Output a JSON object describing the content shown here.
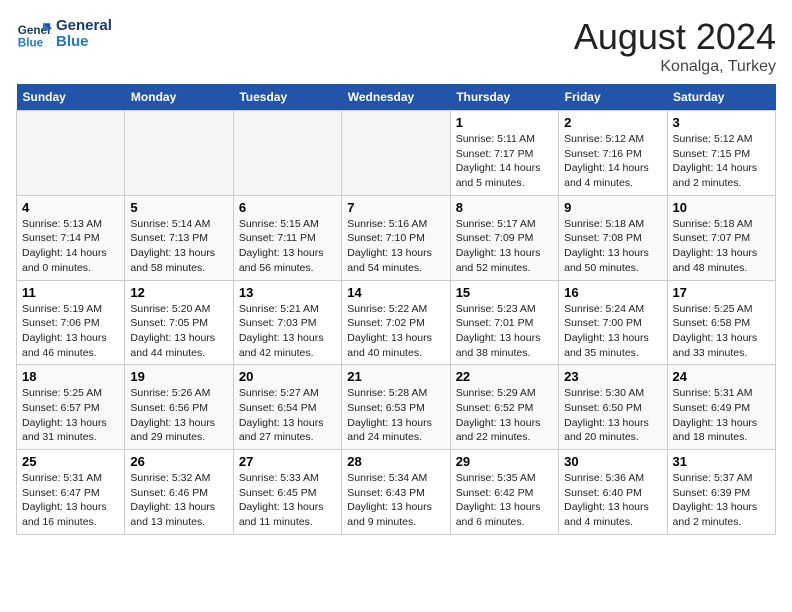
{
  "header": {
    "logo_text_general": "General",
    "logo_text_blue": "Blue",
    "month": "August 2024",
    "location": "Konalga, Turkey"
  },
  "days_of_week": [
    "Sunday",
    "Monday",
    "Tuesday",
    "Wednesday",
    "Thursday",
    "Friday",
    "Saturday"
  ],
  "weeks": [
    [
      {
        "day": null
      },
      {
        "day": null
      },
      {
        "day": null
      },
      {
        "day": null
      },
      {
        "day": "1",
        "sunrise": "5:11 AM",
        "sunset": "7:17 PM",
        "daylight": "14 hours and 5 minutes."
      },
      {
        "day": "2",
        "sunrise": "5:12 AM",
        "sunset": "7:16 PM",
        "daylight": "14 hours and 4 minutes."
      },
      {
        "day": "3",
        "sunrise": "5:12 AM",
        "sunset": "7:15 PM",
        "daylight": "14 hours and 2 minutes."
      }
    ],
    [
      {
        "day": "4",
        "sunrise": "5:13 AM",
        "sunset": "7:14 PM",
        "daylight": "14 hours and 0 minutes."
      },
      {
        "day": "5",
        "sunrise": "5:14 AM",
        "sunset": "7:13 PM",
        "daylight": "13 hours and 58 minutes."
      },
      {
        "day": "6",
        "sunrise": "5:15 AM",
        "sunset": "7:11 PM",
        "daylight": "13 hours and 56 minutes."
      },
      {
        "day": "7",
        "sunrise": "5:16 AM",
        "sunset": "7:10 PM",
        "daylight": "13 hours and 54 minutes."
      },
      {
        "day": "8",
        "sunrise": "5:17 AM",
        "sunset": "7:09 PM",
        "daylight": "13 hours and 52 minutes."
      },
      {
        "day": "9",
        "sunrise": "5:18 AM",
        "sunset": "7:08 PM",
        "daylight": "13 hours and 50 minutes."
      },
      {
        "day": "10",
        "sunrise": "5:18 AM",
        "sunset": "7:07 PM",
        "daylight": "13 hours and 48 minutes."
      }
    ],
    [
      {
        "day": "11",
        "sunrise": "5:19 AM",
        "sunset": "7:06 PM",
        "daylight": "13 hours and 46 minutes."
      },
      {
        "day": "12",
        "sunrise": "5:20 AM",
        "sunset": "7:05 PM",
        "daylight": "13 hours and 44 minutes."
      },
      {
        "day": "13",
        "sunrise": "5:21 AM",
        "sunset": "7:03 PM",
        "daylight": "13 hours and 42 minutes."
      },
      {
        "day": "14",
        "sunrise": "5:22 AM",
        "sunset": "7:02 PM",
        "daylight": "13 hours and 40 minutes."
      },
      {
        "day": "15",
        "sunrise": "5:23 AM",
        "sunset": "7:01 PM",
        "daylight": "13 hours and 38 minutes."
      },
      {
        "day": "16",
        "sunrise": "5:24 AM",
        "sunset": "7:00 PM",
        "daylight": "13 hours and 35 minutes."
      },
      {
        "day": "17",
        "sunrise": "5:25 AM",
        "sunset": "6:58 PM",
        "daylight": "13 hours and 33 minutes."
      }
    ],
    [
      {
        "day": "18",
        "sunrise": "5:25 AM",
        "sunset": "6:57 PM",
        "daylight": "13 hours and 31 minutes."
      },
      {
        "day": "19",
        "sunrise": "5:26 AM",
        "sunset": "6:56 PM",
        "daylight": "13 hours and 29 minutes."
      },
      {
        "day": "20",
        "sunrise": "5:27 AM",
        "sunset": "6:54 PM",
        "daylight": "13 hours and 27 minutes."
      },
      {
        "day": "21",
        "sunrise": "5:28 AM",
        "sunset": "6:53 PM",
        "daylight": "13 hours and 24 minutes."
      },
      {
        "day": "22",
        "sunrise": "5:29 AM",
        "sunset": "6:52 PM",
        "daylight": "13 hours and 22 minutes."
      },
      {
        "day": "23",
        "sunrise": "5:30 AM",
        "sunset": "6:50 PM",
        "daylight": "13 hours and 20 minutes."
      },
      {
        "day": "24",
        "sunrise": "5:31 AM",
        "sunset": "6:49 PM",
        "daylight": "13 hours and 18 minutes."
      }
    ],
    [
      {
        "day": "25",
        "sunrise": "5:31 AM",
        "sunset": "6:47 PM",
        "daylight": "13 hours and 16 minutes."
      },
      {
        "day": "26",
        "sunrise": "5:32 AM",
        "sunset": "6:46 PM",
        "daylight": "13 hours and 13 minutes."
      },
      {
        "day": "27",
        "sunrise": "5:33 AM",
        "sunset": "6:45 PM",
        "daylight": "13 hours and 11 minutes."
      },
      {
        "day": "28",
        "sunrise": "5:34 AM",
        "sunset": "6:43 PM",
        "daylight": "13 hours and 9 minutes."
      },
      {
        "day": "29",
        "sunrise": "5:35 AM",
        "sunset": "6:42 PM",
        "daylight": "13 hours and 6 minutes."
      },
      {
        "day": "30",
        "sunrise": "5:36 AM",
        "sunset": "6:40 PM",
        "daylight": "13 hours and 4 minutes."
      },
      {
        "day": "31",
        "sunrise": "5:37 AM",
        "sunset": "6:39 PM",
        "daylight": "13 hours and 2 minutes."
      }
    ]
  ]
}
